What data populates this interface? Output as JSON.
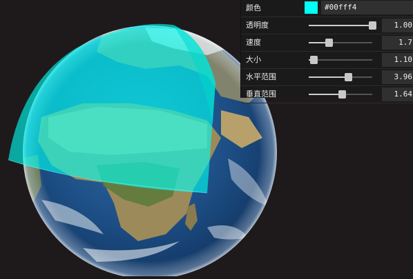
{
  "controls": {
    "color": {
      "label": "颜色",
      "value": "#00fff4"
    },
    "sliders": [
      {
        "key": "opacity",
        "label": "透明度",
        "display": "1.00",
        "level": 1.0
      },
      {
        "key": "speed",
        "label": "速度",
        "display": "1.7",
        "level": 0.32
      },
      {
        "key": "size",
        "label": "大小",
        "display": "1.10",
        "level": 0.08
      },
      {
        "key": "hrange",
        "label": "水平范围",
        "display": "3.96",
        "level": 0.62
      },
      {
        "key": "vrange",
        "label": "垂直范围",
        "display": "1.64",
        "level": 0.52
      }
    ]
  },
  "colors": {
    "background": "#1e1a1b",
    "accent": "#00fff4",
    "panel": "#1a1a1a"
  }
}
